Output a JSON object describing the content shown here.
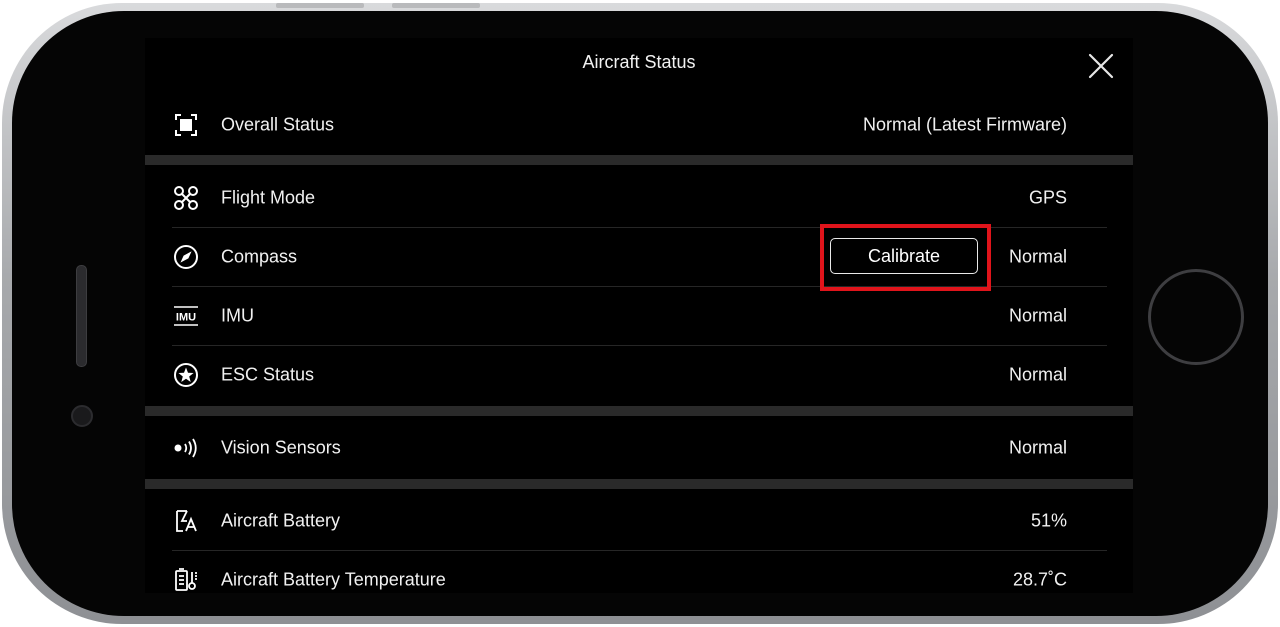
{
  "header": {
    "title": "Aircraft Status",
    "close_icon": "close-icon"
  },
  "rows": [
    {
      "icon": "overall-status-icon",
      "label": "Overall Status",
      "value": "Normal (Latest Firmware)"
    },
    {
      "icon": "drone-icon",
      "label": "Flight Mode",
      "value": "GPS"
    },
    {
      "icon": "compass-icon",
      "label": "Compass",
      "value": "Normal",
      "action": "Calibrate"
    },
    {
      "icon": "imu-icon",
      "label": "IMU",
      "value": "Normal"
    },
    {
      "icon": "esc-icon",
      "label": "ESC Status",
      "value": "Normal"
    },
    {
      "icon": "vision-sensor-icon",
      "label": "Vision Sensors",
      "value": "Normal"
    },
    {
      "icon": "battery-icon",
      "label": "Aircraft Battery",
      "value": "51%"
    },
    {
      "icon": "battery-temperature-icon",
      "label": "Aircraft Battery Temperature",
      "value": "28.7˚C"
    }
  ],
  "imu_icon_text": "IMU",
  "colors": {
    "highlight": "#e0141b",
    "background": "#000000",
    "text": "#f1f1f1"
  }
}
